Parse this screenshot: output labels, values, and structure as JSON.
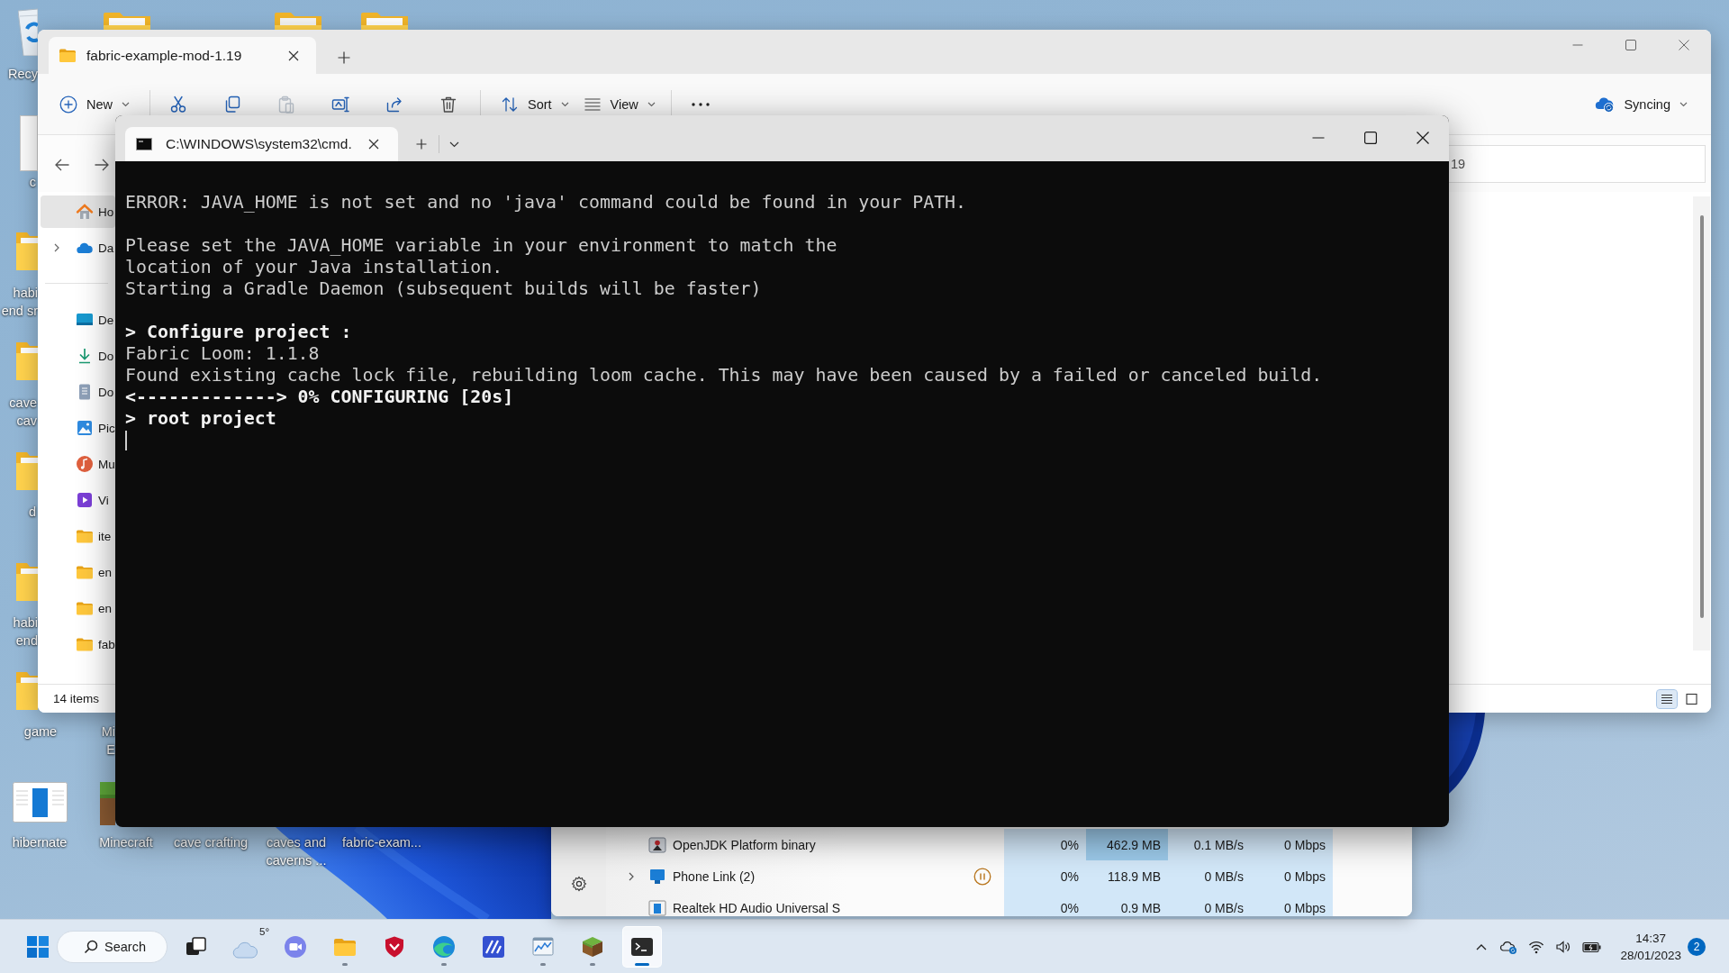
{
  "explorer": {
    "tab_title": "fabric-example-mod-1.19",
    "toolbar": {
      "new": "New",
      "actions": [
        {
          "disabled": false
        },
        {
          "disabled": false
        },
        {
          "disabled": true
        },
        {
          "disabled": false
        },
        {
          "disabled": false
        },
        {
          "disabled": false
        }
      ],
      "sort": "Sort",
      "view": "View",
      "sync": "Syncing"
    },
    "address": "19",
    "sidebar": [
      [
        {
          "label": "Ho",
          "selected": true
        },
        {
          "label": "Da",
          "selected": false,
          "expanded": false
        }
      ],
      [
        {
          "label": "De",
          "selected": false
        },
        {
          "label": "Do",
          "selected": false
        },
        {
          "label": "Do",
          "selected": false
        },
        {
          "label": "Pic",
          "selected": false
        },
        {
          "label": "Mu",
          "selected": false
        },
        {
          "label": "Vi",
          "selected": false
        },
        {
          "label": "ite",
          "selected": false
        },
        {
          "label": "en",
          "selected": false
        },
        {
          "label": "en",
          "selected": false
        },
        {
          "label": "fab",
          "selected": false
        }
      ]
    ],
    "status": "14 items",
    "view_modes": [
      {
        "selected": true
      },
      {
        "selected": false
      }
    ]
  },
  "terminal": {
    "tab_title": "C:\\WINDOWS\\system32\\cmd.",
    "blocks": [
      [
        {
          "text": "ERROR: JAVA_HOME is not set and no 'java' command could be found in your PATH.",
          "bold": false
        }
      ],
      [
        {
          "text": "Please set the JAVA_HOME variable in your environment to match the",
          "bold": false
        },
        {
          "text": "location of your Java installation.",
          "bold": false
        },
        {
          "text": "Starting a Gradle Daemon (subsequent builds will be faster)",
          "bold": false
        }
      ],
      [
        {
          "text": "> Configure project :",
          "bold": true
        },
        {
          "text": "Fabric Loom: 1.1.8",
          "bold": false
        },
        {
          "text": "Found existing cache lock file, rebuilding loom cache. This may have been caused by a failed or canceled build.",
          "bold": false
        },
        {
          "text": "<-------------> 0% CONFIGURING [20s]",
          "bold": true
        },
        {
          "text": "> root project",
          "bold": true
        }
      ]
    ],
    "cursor": true
  },
  "task_manager": {
    "rows": [
      {
        "name": "OpenJDK Platform binary",
        "paused": false,
        "cpu": "0%",
        "memory": "462.9 MB",
        "memory_high": true,
        "disk": "0.1 MB/s",
        "network": "0 Mbps"
      },
      {
        "name": "Phone Link (2)",
        "expanded": false,
        "paused": true,
        "cpu": "0%",
        "memory": "118.9 MB",
        "memory_high": false,
        "disk": "0 MB/s",
        "network": "0 Mbps"
      },
      {
        "name": "Realtek HD Audio Universal S",
        "paused": false,
        "cpu": "0%",
        "memory": "0.9 MB",
        "memory_high": false,
        "disk": "0 MB/s",
        "network": "0 Mbps"
      }
    ]
  },
  "desktop_icons": [
    {
      "lines": [
        "Recy"
      ]
    },
    {
      "lines": [
        "c"
      ]
    },
    {
      "lines": [
        "habi",
        "end sr"
      ]
    },
    {
      "lines": [
        "cave",
        "cav"
      ]
    },
    {
      "lines": [
        "d"
      ]
    },
    {
      "lines": [
        "habi",
        "end"
      ]
    },
    {
      "lines": [
        "game"
      ]
    },
    {
      "lines": [
        "hibernate"
      ]
    },
    {
      "lines": [
        "Mi",
        "E"
      ]
    },
    {
      "lines": [
        "Minecraft"
      ]
    },
    {
      "lines": [
        "cave crafting"
      ]
    },
    {
      "lines": [
        "caves and",
        "caverns ..."
      ]
    },
    {
      "lines": [
        "fabric-exam..."
      ]
    }
  ],
  "taskbar": {
    "search": "Search",
    "weather": "5°",
    "apps": [
      {
        "running": false,
        "selected": false
      },
      {
        "running": false,
        "selected": false
      },
      {
        "running": true,
        "selected": false
      },
      {
        "running": false,
        "selected": false
      },
      {
        "running": true,
        "selected": false
      },
      {
        "running": false,
        "selected": false
      },
      {
        "running": true,
        "selected": false
      },
      {
        "running": true,
        "selected": false
      },
      {
        "running": true,
        "selected": true
      }
    ],
    "time": "14:37",
    "date": "28/01/2023",
    "notifications": "2"
  }
}
